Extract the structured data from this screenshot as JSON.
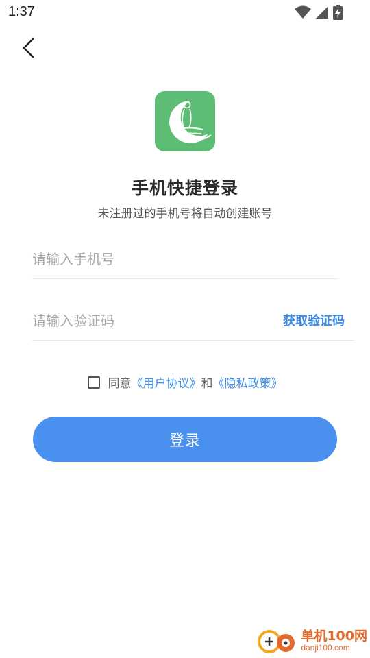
{
  "status_bar": {
    "time": "1:37",
    "icons": [
      "wifi-icon",
      "signal-icon",
      "battery-charging-icon"
    ]
  },
  "nav": {
    "back_icon": "chevron-left-icon"
  },
  "logo": {
    "icon": "massage-app-logo",
    "color": "#5dbd74"
  },
  "header": {
    "title": "手机快捷登录",
    "subtitle": "未注册过的手机号将自动创建账号"
  },
  "form": {
    "phone_placeholder": "请输入手机号",
    "phone_value": "",
    "code_placeholder": "请输入验证码",
    "code_value": "",
    "get_code_label": "获取验证码"
  },
  "agreement": {
    "checked": false,
    "prefix": "同意",
    "user_agreement": "《用户协议》",
    "and": "和",
    "privacy_policy": "《隐私政策》"
  },
  "login_button": "登录",
  "watermark": {
    "logo": "danji100-logo",
    "text": "单机100网",
    "url": "danji100.com"
  },
  "colors": {
    "accent": "#4a90ef",
    "link": "#3d8de8",
    "brand_green": "#5dbd74",
    "watermark": "#e36a2d"
  }
}
